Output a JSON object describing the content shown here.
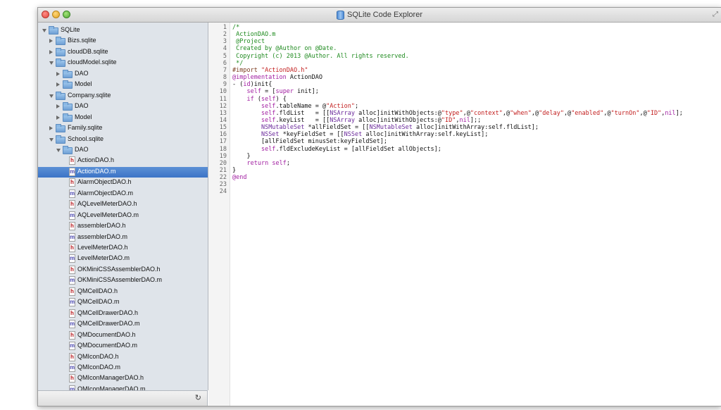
{
  "window": {
    "title": "SQLite Code Explorer"
  },
  "colors": {
    "selection": "#3c74c7",
    "comment": "#1e8a1e",
    "string": "#c21d1d",
    "keyword": "#a11ea1"
  },
  "icons": {
    "root": "folder-icon",
    "header_file": "h-file-icon",
    "impl_file": "m-file-icon",
    "refresh": "refresh-icon"
  },
  "tree": [
    {
      "label": "SQLite",
      "type": "folder",
      "expanded": true,
      "depth": 0
    },
    {
      "label": "Bizs.sqlite",
      "type": "folder",
      "expanded": false,
      "depth": 1
    },
    {
      "label": "cloudDB.sqlite",
      "type": "folder",
      "expanded": false,
      "depth": 1
    },
    {
      "label": "cloudModel.sqlite",
      "type": "folder",
      "expanded": true,
      "depth": 1
    },
    {
      "label": "DAO",
      "type": "folder",
      "expanded": false,
      "depth": 2
    },
    {
      "label": "Model",
      "type": "folder",
      "expanded": false,
      "depth": 2
    },
    {
      "label": "Company.sqlite",
      "type": "folder",
      "expanded": true,
      "depth": 1
    },
    {
      "label": "DAO",
      "type": "folder",
      "expanded": false,
      "depth": 2
    },
    {
      "label": "Model",
      "type": "folder",
      "expanded": false,
      "depth": 2
    },
    {
      "label": "Family.sqlite",
      "type": "folder",
      "expanded": false,
      "depth": 1
    },
    {
      "label": "School.sqlite",
      "type": "folder",
      "expanded": true,
      "depth": 1
    },
    {
      "label": "DAO",
      "type": "folder",
      "expanded": true,
      "depth": 2
    },
    {
      "label": "ActionDAO.h",
      "type": "h",
      "depth": 3
    },
    {
      "label": "ActionDAO.m",
      "type": "m",
      "depth": 3,
      "selected": true
    },
    {
      "label": "AlarmObjectDAO.h",
      "type": "h",
      "depth": 3
    },
    {
      "label": "AlarmObjectDAO.m",
      "type": "m",
      "depth": 3
    },
    {
      "label": "AQLevelMeterDAO.h",
      "type": "h",
      "depth": 3
    },
    {
      "label": "AQLevelMeterDAO.m",
      "type": "m",
      "depth": 3
    },
    {
      "label": "assemblerDAO.h",
      "type": "h",
      "depth": 3
    },
    {
      "label": "assemblerDAO.m",
      "type": "m",
      "depth": 3
    },
    {
      "label": "LevelMeterDAO.h",
      "type": "h",
      "depth": 3
    },
    {
      "label": "LevelMeterDAO.m",
      "type": "m",
      "depth": 3
    },
    {
      "label": "OKMiniCSSAssemblerDAO.h",
      "type": "h",
      "depth": 3
    },
    {
      "label": "OKMiniCSSAssemblerDAO.m",
      "type": "m",
      "depth": 3
    },
    {
      "label": "QMCellDAO.h",
      "type": "h",
      "depth": 3
    },
    {
      "label": "QMCellDAO.m",
      "type": "m",
      "depth": 3
    },
    {
      "label": "QMCellDrawerDAO.h",
      "type": "h",
      "depth": 3
    },
    {
      "label": "QMCellDrawerDAO.m",
      "type": "m",
      "depth": 3
    },
    {
      "label": "QMDocumentDAO.h",
      "type": "h",
      "depth": 3
    },
    {
      "label": "QMDocumentDAO.m",
      "type": "m",
      "depth": 3
    },
    {
      "label": "QMIconDAO.h",
      "type": "h",
      "depth": 3
    },
    {
      "label": "QMIconDAO.m",
      "type": "m",
      "depth": 3
    },
    {
      "label": "QMIconManagerDAO.h",
      "type": "h",
      "depth": 3
    },
    {
      "label": "QMIconManagerDAO.m",
      "type": "m",
      "depth": 3
    }
  ],
  "code": [
    {
      "n": "1",
      "parts": [
        {
          "t": "/*",
          "c": "comment"
        }
      ]
    },
    {
      "n": "2",
      "parts": [
        {
          "t": " ActionDAO.m",
          "c": "comment"
        }
      ]
    },
    {
      "n": "3",
      "parts": [
        {
          "t": " @Project",
          "c": "comment"
        }
      ]
    },
    {
      "n": "4",
      "parts": [
        {
          "t": " Created by @Author on @Date.",
          "c": "comment"
        }
      ]
    },
    {
      "n": "5",
      "parts": [
        {
          "t": " Copyright (c) 2013 @Author. All rights reserved.",
          "c": "comment"
        }
      ]
    },
    {
      "n": "6",
      "parts": [
        {
          "t": " */",
          "c": "comment"
        }
      ]
    },
    {
      "n": "7",
      "parts": [
        {
          "t": "#import ",
          "c": "pp"
        },
        {
          "t": "\"ActionDAO.h\"",
          "c": "str"
        }
      ]
    },
    {
      "n": "8",
      "parts": [
        {
          "t": "@implementation",
          "c": "kw"
        },
        {
          "t": " ActionDAO",
          "c": "plain"
        }
      ]
    },
    {
      "n": "9",
      "parts": [
        {
          "t": "- (",
          "c": "plain"
        },
        {
          "t": "id",
          "c": "kw"
        },
        {
          "t": ")init{",
          "c": "plain"
        }
      ]
    },
    {
      "n": "10",
      "parts": [
        {
          "t": "    ",
          "c": "plain"
        },
        {
          "t": "self",
          "c": "kw"
        },
        {
          "t": " = [",
          "c": "plain"
        },
        {
          "t": "super",
          "c": "kw"
        },
        {
          "t": " init];",
          "c": "plain"
        }
      ]
    },
    {
      "n": "11",
      "parts": [
        {
          "t": "    ",
          "c": "plain"
        },
        {
          "t": "if",
          "c": "kw"
        },
        {
          "t": " (",
          "c": "plain"
        },
        {
          "t": "self",
          "c": "kw"
        },
        {
          "t": ") {",
          "c": "plain"
        }
      ]
    },
    {
      "n": "12",
      "parts": [
        {
          "t": "        ",
          "c": "plain"
        },
        {
          "t": "self",
          "c": "kw"
        },
        {
          "t": ".tableName = @",
          "c": "plain"
        },
        {
          "t": "\"Action\"",
          "c": "str"
        },
        {
          "t": ";",
          "c": "plain"
        }
      ]
    },
    {
      "n": "13",
      "parts": [
        {
          "t": "        ",
          "c": "plain"
        },
        {
          "t": "self",
          "c": "kw"
        },
        {
          "t": ".fldList   = [[",
          "c": "plain"
        },
        {
          "t": "NSArray",
          "c": "cls"
        },
        {
          "t": " alloc]initWithObjects:@",
          "c": "plain"
        },
        {
          "t": "\"type\"",
          "c": "str"
        },
        {
          "t": ",@",
          "c": "plain"
        },
        {
          "t": "\"context\"",
          "c": "str"
        },
        {
          "t": ",@",
          "c": "plain"
        },
        {
          "t": "\"when\"",
          "c": "str"
        },
        {
          "t": ",@",
          "c": "plain"
        },
        {
          "t": "\"delay\"",
          "c": "str"
        },
        {
          "t": ",@",
          "c": "plain"
        },
        {
          "t": "\"enabled\"",
          "c": "str"
        },
        {
          "t": ",@",
          "c": "plain"
        },
        {
          "t": "\"turnOn\"",
          "c": "str"
        },
        {
          "t": ",@",
          "c": "plain"
        },
        {
          "t": "\"ID\"",
          "c": "str"
        },
        {
          "t": ",",
          "c": "plain"
        },
        {
          "t": "nil",
          "c": "kw"
        },
        {
          "t": "];",
          "c": "plain"
        }
      ]
    },
    {
      "n": "14",
      "parts": [
        {
          "t": "        ",
          "c": "plain"
        },
        {
          "t": "self",
          "c": "kw"
        },
        {
          "t": ".keyList   = [[",
          "c": "plain"
        },
        {
          "t": "NSArray",
          "c": "cls"
        },
        {
          "t": " alloc]initWithObjects:@",
          "c": "plain"
        },
        {
          "t": "\"ID\"",
          "c": "str"
        },
        {
          "t": ",",
          "c": "plain"
        },
        {
          "t": "nil",
          "c": "kw"
        },
        {
          "t": "];;",
          "c": "plain"
        }
      ]
    },
    {
      "n": "15",
      "parts": [
        {
          "t": "        ",
          "c": "plain"
        },
        {
          "t": "NSMutableSet",
          "c": "cls"
        },
        {
          "t": " *allFieldSet = [[",
          "c": "plain"
        },
        {
          "t": "NSMutableSet",
          "c": "cls"
        },
        {
          "t": " alloc]initWithArray:self.fldList];",
          "c": "plain"
        }
      ]
    },
    {
      "n": "16",
      "parts": [
        {
          "t": "        ",
          "c": "plain"
        },
        {
          "t": "NSSet",
          "c": "cls"
        },
        {
          "t": " *keyFieldSet = [[",
          "c": "plain"
        },
        {
          "t": "NSSet",
          "c": "cls"
        },
        {
          "t": " alloc]initWithArray:self.keyList];",
          "c": "plain"
        }
      ]
    },
    {
      "n": "17",
      "parts": [
        {
          "t": "        [allFieldSet minusSet:keyFieldSet];",
          "c": "plain"
        }
      ]
    },
    {
      "n": "18",
      "parts": [
        {
          "t": "        ",
          "c": "plain"
        },
        {
          "t": "self",
          "c": "kw"
        },
        {
          "t": ".fldExcludeKeyList = [allFieldSet allObjects];",
          "c": "plain"
        }
      ]
    },
    {
      "n": "19",
      "parts": [
        {
          "t": "    }",
          "c": "plain"
        }
      ]
    },
    {
      "n": "20",
      "parts": [
        {
          "t": "    ",
          "c": "plain"
        },
        {
          "t": "return",
          "c": "kw"
        },
        {
          "t": " ",
          "c": "plain"
        },
        {
          "t": "self",
          "c": "kw"
        },
        {
          "t": ";",
          "c": "plain"
        }
      ]
    },
    {
      "n": "21",
      "parts": [
        {
          "t": "}",
          "c": "plain"
        }
      ]
    },
    {
      "n": "22",
      "parts": [
        {
          "t": "@end",
          "c": "kw"
        }
      ]
    },
    {
      "n": "23",
      "parts": []
    },
    {
      "n": "24",
      "parts": []
    }
  ]
}
